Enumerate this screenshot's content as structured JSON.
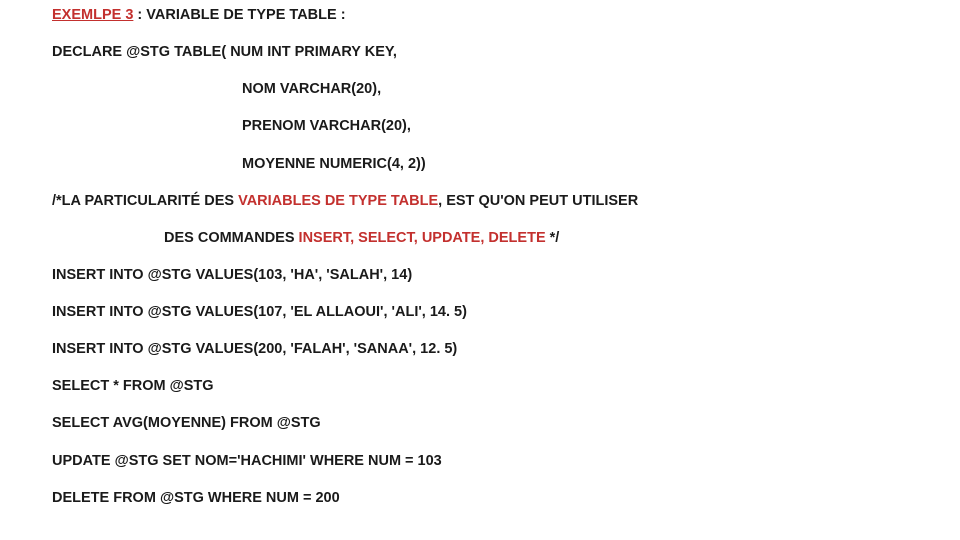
{
  "title_red": "EXEMLPE 3",
  "title_rest": " : VARIABLE DE TYPE TABLE :",
  "declare": "DECLARE @STG TABLE( NUM INT PRIMARY KEY,",
  "col_nom": "NOM VARCHAR(20),",
  "col_prenom": "PRENOM VARCHAR(20),",
  "col_moyenne": "MOYENNE NUMERIC(4, 2))",
  "cmt1a": "/*LA PARTICULARITÉ DES ",
  "cmt1b": "VARIABLES DE TYPE TABLE",
  "cmt1c": ", EST QU'ON PEUT UTILISER",
  "cmt2a": "DES COMMANDES ",
  "cmt2b": "INSERT, SELECT, UPDATE, DELETE",
  "cmt2c": " */",
  "ins1": "INSERT INTO @STG VALUES(103, 'HA', 'SALAH', 14)",
  "ins2": "INSERT INTO @STG VALUES(107, 'EL ALLAOUI', 'ALI', 14. 5)",
  "ins3": "INSERT INTO @STG VALUES(200, 'FALAH', 'SANAA', 12. 5)",
  "sel1": "SELECT * FROM @STG",
  "sel2": "SELECT AVG(MOYENNE) FROM @STG",
  "upd": "UPDATE @STG SET NOM='HACHIMI' WHERE NUM = 103",
  "del": "DELETE FROM @STG WHERE NUM = 200"
}
